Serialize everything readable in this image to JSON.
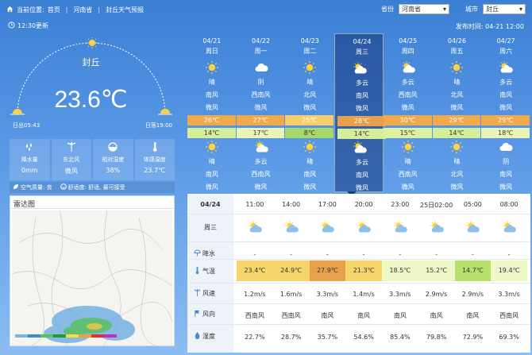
{
  "breadcrumb": {
    "current_label": "当前位置:",
    "home": "首页",
    "province": "河南省",
    "page": "封丘天气预报"
  },
  "selectors": {
    "province_label": "省份",
    "province_value": "河南省",
    "city_label": "城市",
    "city_value": "封丘"
  },
  "updated": "12:30更新",
  "published": "发布时间: 04-21 12:00",
  "current": {
    "city": "封丘",
    "temperature": "23.6℃",
    "sunrise": "日出05:43",
    "sunset": "日落19:00"
  },
  "stats": [
    {
      "icon": "raindrops-icon",
      "label": "降水量",
      "value": "0mm"
    },
    {
      "icon": "wind-icon",
      "label": "东北风",
      "value": "微风"
    },
    {
      "icon": "humidity-icon",
      "label": "相对湿度",
      "value": "38%"
    },
    {
      "icon": "thermometer-icon",
      "label": "体感温度",
      "value": "23.7℃"
    }
  ],
  "air": {
    "quality": "空气质量: 良",
    "comfort": "舒适度: 舒适, 最可接受"
  },
  "radar": {
    "title": "雷达图"
  },
  "colors": {
    "accent": "#3b7fd4",
    "selected_day": "#163f7a"
  },
  "daily": [
    {
      "date": "04/21",
      "week": "周日",
      "day_icon": "sun-icon",
      "day_weather": "晴",
      "day_wind_dir": "南风",
      "day_wind": "微风",
      "high": "26℃",
      "high_color": "#f0a94b",
      "low": "14℃",
      "low_color": "#d6ee9a",
      "night_icon": "sun-icon",
      "night_weather": "晴",
      "night_wind_dir": "南风",
      "night_wind": "微风"
    },
    {
      "date": "04/22",
      "week": "周一",
      "day_icon": "cloud-icon",
      "day_weather": "阴",
      "day_wind_dir": "西南风",
      "day_wind": "微风",
      "high": "27℃",
      "high_color": "#f0a94b",
      "low": "17℃",
      "low_color": "#e9f5b8",
      "night_icon": "partly-cloudy-icon",
      "night_weather": "多云",
      "night_wind_dir": "西南风",
      "night_wind": "微风"
    },
    {
      "date": "04/23",
      "week": "周二",
      "day_icon": "sun-icon",
      "day_weather": "晴",
      "day_wind_dir": "北风",
      "day_wind": "微风",
      "high": "25℃",
      "high_color": "#f6cf6a",
      "low": "8℃",
      "low_color": "#a7d86a",
      "night_icon": "sun-icon",
      "night_weather": "晴",
      "night_wind_dir": "南风",
      "night_wind": "微风"
    },
    {
      "date": "04/24",
      "week": "周三",
      "day_icon": "partly-cloudy-icon",
      "day_weather": "多云",
      "day_wind_dir": "南风",
      "day_wind": "微风",
      "high": "28℃",
      "high_color": "#e8a04a",
      "low": "14℃",
      "low_color": "#d6ee9a",
      "night_icon": "partly-cloudy-icon",
      "night_weather": "多云",
      "night_wind_dir": "南风",
      "night_wind": "微风"
    },
    {
      "date": "04/25",
      "week": "周四",
      "day_icon": "partly-cloudy-icon",
      "day_weather": "多云",
      "day_wind_dir": "西南风",
      "day_wind": "微风",
      "high": "30℃",
      "high_color": "#f0a94b",
      "low": "15℃",
      "low_color": "#dcf0a2",
      "night_icon": "sun-icon",
      "night_weather": "晴",
      "night_wind_dir": "西南风",
      "night_wind": "微风"
    },
    {
      "date": "04/26",
      "week": "周五",
      "day_icon": "sun-icon",
      "day_weather": "晴",
      "day_wind_dir": "北风",
      "day_wind": "微风",
      "high": "29℃",
      "high_color": "#f0a94b",
      "low": "14℃",
      "low_color": "#d6ee9a",
      "night_icon": "sun-icon",
      "night_weather": "晴",
      "night_wind_dir": "北风",
      "night_wind": "微风"
    },
    {
      "date": "04/27",
      "week": "周六",
      "day_icon": "partly-cloudy-icon",
      "day_weather": "多云",
      "day_wind_dir": "南风",
      "day_wind": "微风",
      "high": "29℃",
      "high_color": "#f0a94b",
      "low": "18℃",
      "low_color": "#e9f5b8",
      "night_icon": "cloud-icon",
      "night_weather": "阴",
      "night_wind_dir": "南风",
      "night_wind": "微风"
    }
  ],
  "hourly": {
    "date": "04/24",
    "week": "周三",
    "labels": {
      "precip": "降水",
      "temp": "气温",
      "wind_speed": "风速",
      "wind_dir": "风向",
      "humidity": "湿度"
    },
    "items": [
      {
        "time": "11:00",
        "icon": "partly-cloudy-icon",
        "precip": "-",
        "temp": "23.4℃",
        "temp_color": "#f6d56c",
        "wind_speed": "1.2m/s",
        "wind_dir": "西南风",
        "humidity": "22.7%"
      },
      {
        "time": "14:00",
        "icon": "partly-cloudy-icon",
        "precip": "-",
        "temp": "24.9℃",
        "temp_color": "#f6d56c",
        "wind_speed": "1.6m/s",
        "wind_dir": "西南风",
        "humidity": "28.7%"
      },
      {
        "time": "17:00",
        "icon": "partly-cloudy-icon",
        "precip": "-",
        "temp": "27.9℃",
        "temp_color": "#e8a04a",
        "wind_speed": "3.3m/s",
        "wind_dir": "南风",
        "humidity": "35.7%"
      },
      {
        "time": "20:00",
        "icon": "partly-cloudy-icon",
        "precip": "-",
        "temp": "21.3℃",
        "temp_color": "#f6d56c",
        "wind_speed": "1.4m/s",
        "wind_dir": "南风",
        "humidity": "54.6%"
      },
      {
        "time": "23:00",
        "icon": "partly-cloudy-icon",
        "precip": "-",
        "temp": "18.5℃",
        "temp_color": "#eef7c6",
        "wind_speed": "3.3m/s",
        "wind_dir": "南风",
        "humidity": "85.4%"
      },
      {
        "time": "25日02:00",
        "icon": "partly-cloudy-icon",
        "precip": "-",
        "temp": "15.2℃",
        "temp_color": "#eef7c6",
        "wind_speed": "2.9m/s",
        "wind_dir": "南风",
        "humidity": "79.8%"
      },
      {
        "time": "05:00",
        "icon": "partly-cloudy-icon",
        "precip": "-",
        "temp": "14.7℃",
        "temp_color": "#b7e06c",
        "wind_speed": "2.9m/s",
        "wind_dir": "南风",
        "humidity": "72.9%"
      },
      {
        "time": "08:00",
        "icon": "partly-cloudy-icon",
        "precip": "-",
        "temp": "19.4℃",
        "temp_color": "#eef7c6",
        "wind_speed": "3.3m/s",
        "wind_dir": "西南风",
        "humidity": "69.3%"
      }
    ]
  }
}
